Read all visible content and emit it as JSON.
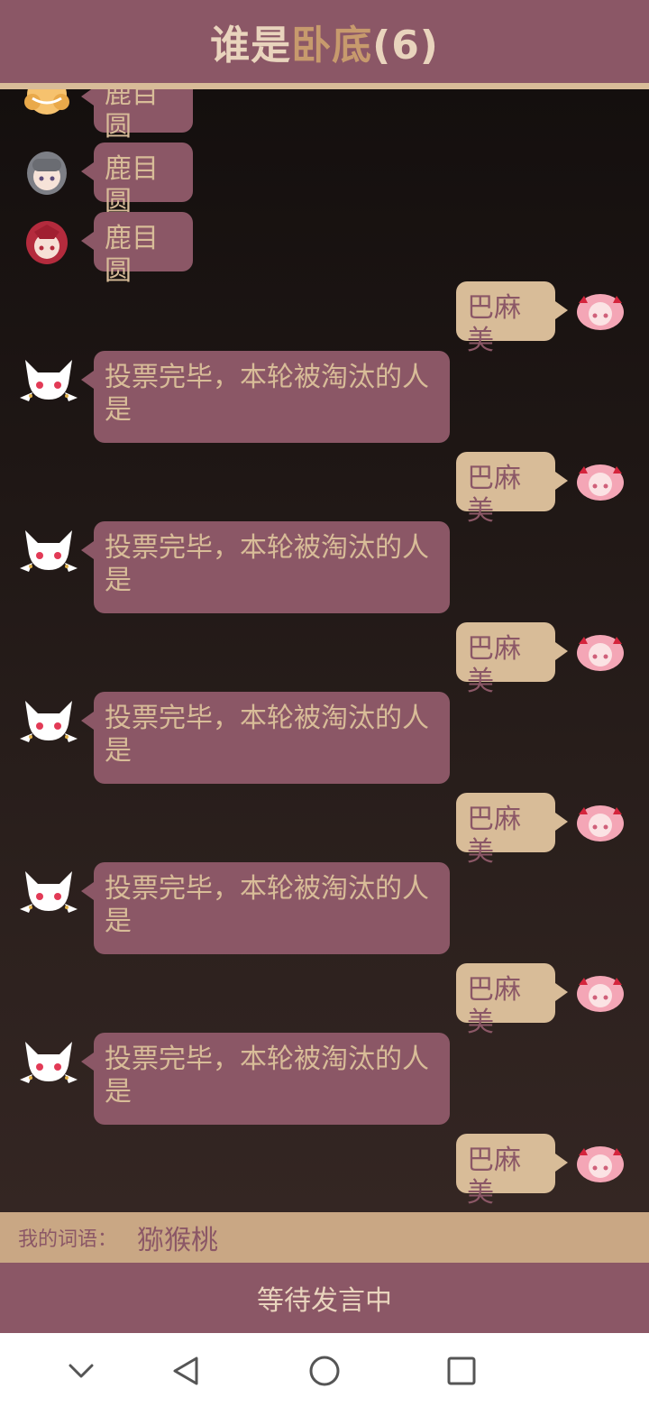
{
  "header": {
    "title_part1": "谁是",
    "title_part2": "卧底",
    "title_part3": "(6)"
  },
  "messages": [
    {
      "side": "left",
      "avatar": "yellow-hair-girl-avatar-icon",
      "text": "鹿目圆"
    },
    {
      "side": "left",
      "avatar": "gray-hair-girl-avatar-icon",
      "text": "鹿目圆"
    },
    {
      "side": "left",
      "avatar": "red-hair-girl-avatar-icon",
      "text": "鹿目圆"
    },
    {
      "side": "right",
      "avatar": "pink-hair-girl-avatar-icon",
      "text": "巴麻美"
    },
    {
      "side": "left",
      "avatar": "white-cat-avatar-icon",
      "text": "投票完毕，本轮被淘汰的人是"
    },
    {
      "side": "right",
      "avatar": "pink-hair-girl-avatar-icon",
      "text": "巴麻美"
    },
    {
      "side": "left",
      "avatar": "white-cat-avatar-icon",
      "text": "投票完毕，本轮被淘汰的人是"
    },
    {
      "side": "right",
      "avatar": "pink-hair-girl-avatar-icon",
      "text": "巴麻美"
    },
    {
      "side": "left",
      "avatar": "white-cat-avatar-icon",
      "text": "投票完毕，本轮被淘汰的人是"
    },
    {
      "side": "right",
      "avatar": "pink-hair-girl-avatar-icon",
      "text": "巴麻美"
    },
    {
      "side": "left",
      "avatar": "white-cat-avatar-icon",
      "text": "投票完毕，本轮被淘汰的人是"
    },
    {
      "side": "right",
      "avatar": "pink-hair-girl-avatar-icon",
      "text": "巴麻美"
    },
    {
      "side": "left",
      "avatar": "white-cat-avatar-icon",
      "text": "投票完毕，本轮被淘汰的人是"
    },
    {
      "side": "right",
      "avatar": "pink-hair-girl-avatar-icon",
      "text": "巴麻美"
    }
  ],
  "wordbar": {
    "label": "我的词语：",
    "word": "猕猴桃"
  },
  "status": {
    "text": "等待发言中"
  },
  "navbar": [
    "chevron-down-icon",
    "back-triangle-icon",
    "home-circle-icon",
    "recents-square-icon"
  ],
  "colors": {
    "primary": "#8b5766",
    "accent": "#d8bc98",
    "wordbar": "#c9a784"
  }
}
